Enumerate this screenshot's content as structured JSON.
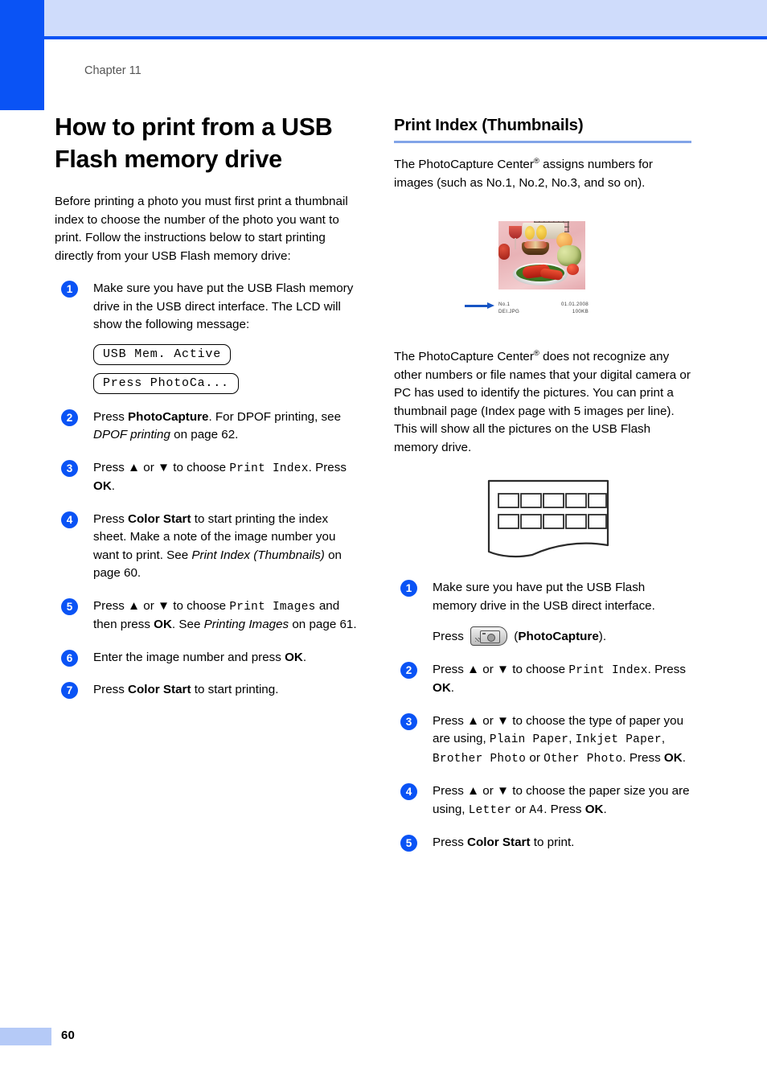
{
  "page": {
    "chapter_label": "Chapter 11",
    "page_number": "60"
  },
  "left_column": {
    "title": "How to print from a USB Flash memory drive",
    "intro": "Before printing a photo you must first print a thumbnail index to choose the number of the photo you want to print. Follow the instructions below to start printing directly from your USB Flash memory drive:",
    "steps": [
      {
        "num": "1",
        "text_a": "Make sure you have put the USB Flash memory drive in the USB direct interface. The LCD will show the following message:"
      },
      {
        "num": "2",
        "text_a": "Press ",
        "bold_a": "PhotoCapture",
        "text_b": ". For DPOF printing, see ",
        "italic_a": "DPOF printing",
        "text_c": " on page 62."
      },
      {
        "num": "3",
        "text_a": "Press ▲ or ▼ to choose ",
        "mono_a": "Print Index",
        "text_b": ". Press ",
        "bold_a": "OK",
        "text_c": "."
      },
      {
        "num": "4",
        "text_a": "Press ",
        "bold_a": "Color Start",
        "text_b": " to start printing the index sheet. Make a note of the image number you want to print. See ",
        "italic_a": "Print Index (Thumbnails)",
        "text_c": " on page 60."
      },
      {
        "num": "5",
        "text_a": "Press ▲ or ▼ to choose ",
        "mono_a": "Print Images",
        "text_b": " and then press ",
        "bold_a": "OK",
        "text_c": ". See ",
        "italic_a": "Printing Images",
        "text_d": " on page 61."
      },
      {
        "num": "6",
        "text_a": "Enter the image number and press ",
        "bold_a": "OK",
        "text_b": "."
      },
      {
        "num": "7",
        "text_a": "Press ",
        "bold_a": "Color Start",
        "text_b": " to start printing."
      }
    ],
    "lcd_messages": [
      "USB Mem. Active",
      "Press PhotoCa..."
    ]
  },
  "right_column": {
    "title": "Print Index (Thumbnails)",
    "paragraph_1_a": "The PhotoCapture Center",
    "paragraph_1_sup": "®",
    "paragraph_1_b": " assigns numbers for images (such as No.1, No.2, No.3, and so on).",
    "paragraph_2_a": "The PhotoCapture Center",
    "paragraph_2_sup": "®",
    "paragraph_2_b": " does not recognize any other numbers or file names that your digital camera or PC has used to identify the pictures. You can print a thumbnail page (Index page with 5 images per line). This will show all the pictures on the USB Flash memory drive.",
    "photo_caption": {
      "number": "No.1",
      "filename": "DEI.JPG",
      "date": "01.01.2008",
      "size": "100KB"
    },
    "steps": [
      {
        "num": "1",
        "text_a": "Make sure you have put the USB Flash memory drive in the USB direct interface.",
        "press_label": "Press",
        "paren_open": "(",
        "bold_a": "PhotoCapture",
        "paren_close": ")."
      },
      {
        "num": "2",
        "text_a": "Press ▲ or ▼ to choose ",
        "mono_a": "Print Index",
        "text_b": ". Press ",
        "bold_a": "OK",
        "text_c": "."
      },
      {
        "num": "3",
        "text_a": "Press ▲ or ▼ to choose the type of paper you are using, ",
        "mono_a": "Plain Paper",
        "text_b": ", ",
        "mono_b": "Inkjet Paper",
        "text_c": ", ",
        "mono_c": "Brother Photo",
        "text_d": " or ",
        "mono_d": "Other Photo",
        "text_e": ". Press ",
        "bold_a": "OK",
        "text_f": "."
      },
      {
        "num": "4",
        "text_a": "Press ▲ or ▼ to choose the paper size you are using, ",
        "mono_a": "Letter",
        "text_b": " or ",
        "mono_b": "A4",
        "text_c": ". Press ",
        "bold_a": "OK",
        "text_d": "."
      },
      {
        "num": "5",
        "text_a": "Press ",
        "bold_a": "Color Start",
        "text_b": " to print."
      }
    ]
  },
  "colors": {
    "accent_blue": "#0a53f5",
    "header_band": "#cfdcfb",
    "rule_blue": "#82a4e8",
    "footer_bar": "#b5caf7"
  }
}
